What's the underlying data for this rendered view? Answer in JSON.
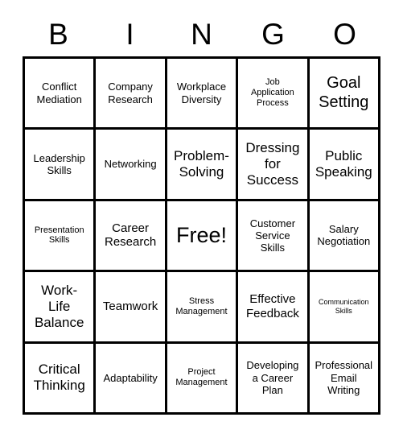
{
  "header": {
    "letters": [
      "B",
      "I",
      "N",
      "G",
      "O"
    ]
  },
  "grid": {
    "free_space_label": "Free!",
    "rows": [
      [
        {
          "label": "Conflict\nMediation",
          "size": "md"
        },
        {
          "label": "Company\nResearch",
          "size": "md"
        },
        {
          "label": "Workplace\nDiversity",
          "size": "md"
        },
        {
          "label": "Job\nApplication\nProcess",
          "size": "sm"
        },
        {
          "label": "Goal\nSetting",
          "size": "xxl"
        }
      ],
      [
        {
          "label": "Leadership\nSkills",
          "size": "md"
        },
        {
          "label": "Networking",
          "size": "md"
        },
        {
          "label": "Problem-\nSolving",
          "size": "xl"
        },
        {
          "label": "Dressing\nfor\nSuccess",
          "size": "xl"
        },
        {
          "label": "Public\nSpeaking",
          "size": "xl"
        }
      ],
      [
        {
          "label": "Presentation\nSkills",
          "size": "sm"
        },
        {
          "label": "Career\nResearch",
          "size": "lg"
        },
        {
          "label": "Free!",
          "size": "free"
        },
        {
          "label": "Customer\nService\nSkills",
          "size": "md"
        },
        {
          "label": "Salary\nNegotiation",
          "size": "md"
        }
      ],
      [
        {
          "label": "Work-\nLife\nBalance",
          "size": "xl"
        },
        {
          "label": "Teamwork",
          "size": "lg"
        },
        {
          "label": "Stress\nManagement",
          "size": "sm"
        },
        {
          "label": "Effective\nFeedback",
          "size": "lg"
        },
        {
          "label": "Communication\nSkills",
          "size": "xs"
        }
      ],
      [
        {
          "label": "Critical\nThinking",
          "size": "xl"
        },
        {
          "label": "Adaptability",
          "size": "md"
        },
        {
          "label": "Project\nManagement",
          "size": "sm"
        },
        {
          "label": "Developing\na Career\nPlan",
          "size": "md"
        },
        {
          "label": "Professional\nEmail\nWriting",
          "size": "md"
        }
      ]
    ]
  }
}
